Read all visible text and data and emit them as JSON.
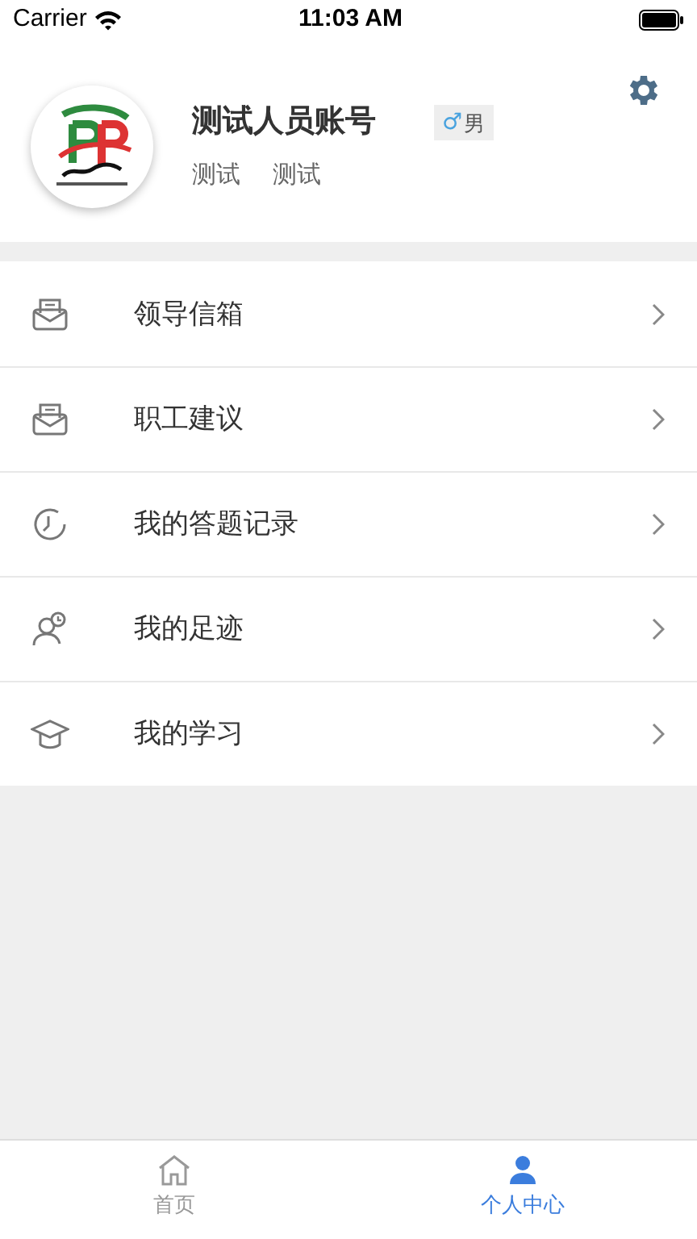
{
  "status_bar": {
    "carrier": "Carrier",
    "time": "11:03 AM"
  },
  "profile": {
    "name": "测试人员账号",
    "gender_symbol": "♂",
    "gender": "男",
    "tags": [
      "测试",
      "测试"
    ]
  },
  "menu": [
    {
      "label": "领导信箱",
      "kind": "mail"
    },
    {
      "label": "职工建议",
      "kind": "mail"
    },
    {
      "label": "我的答题记录",
      "kind": "clock"
    },
    {
      "label": "我的足迹",
      "kind": "person"
    },
    {
      "label": "我的学习",
      "kind": "cap"
    }
  ],
  "tab_bar": [
    {
      "label": "首页",
      "kind": "home",
      "selected": false
    },
    {
      "label": "个人中心",
      "kind": "user",
      "selected": true
    }
  ]
}
